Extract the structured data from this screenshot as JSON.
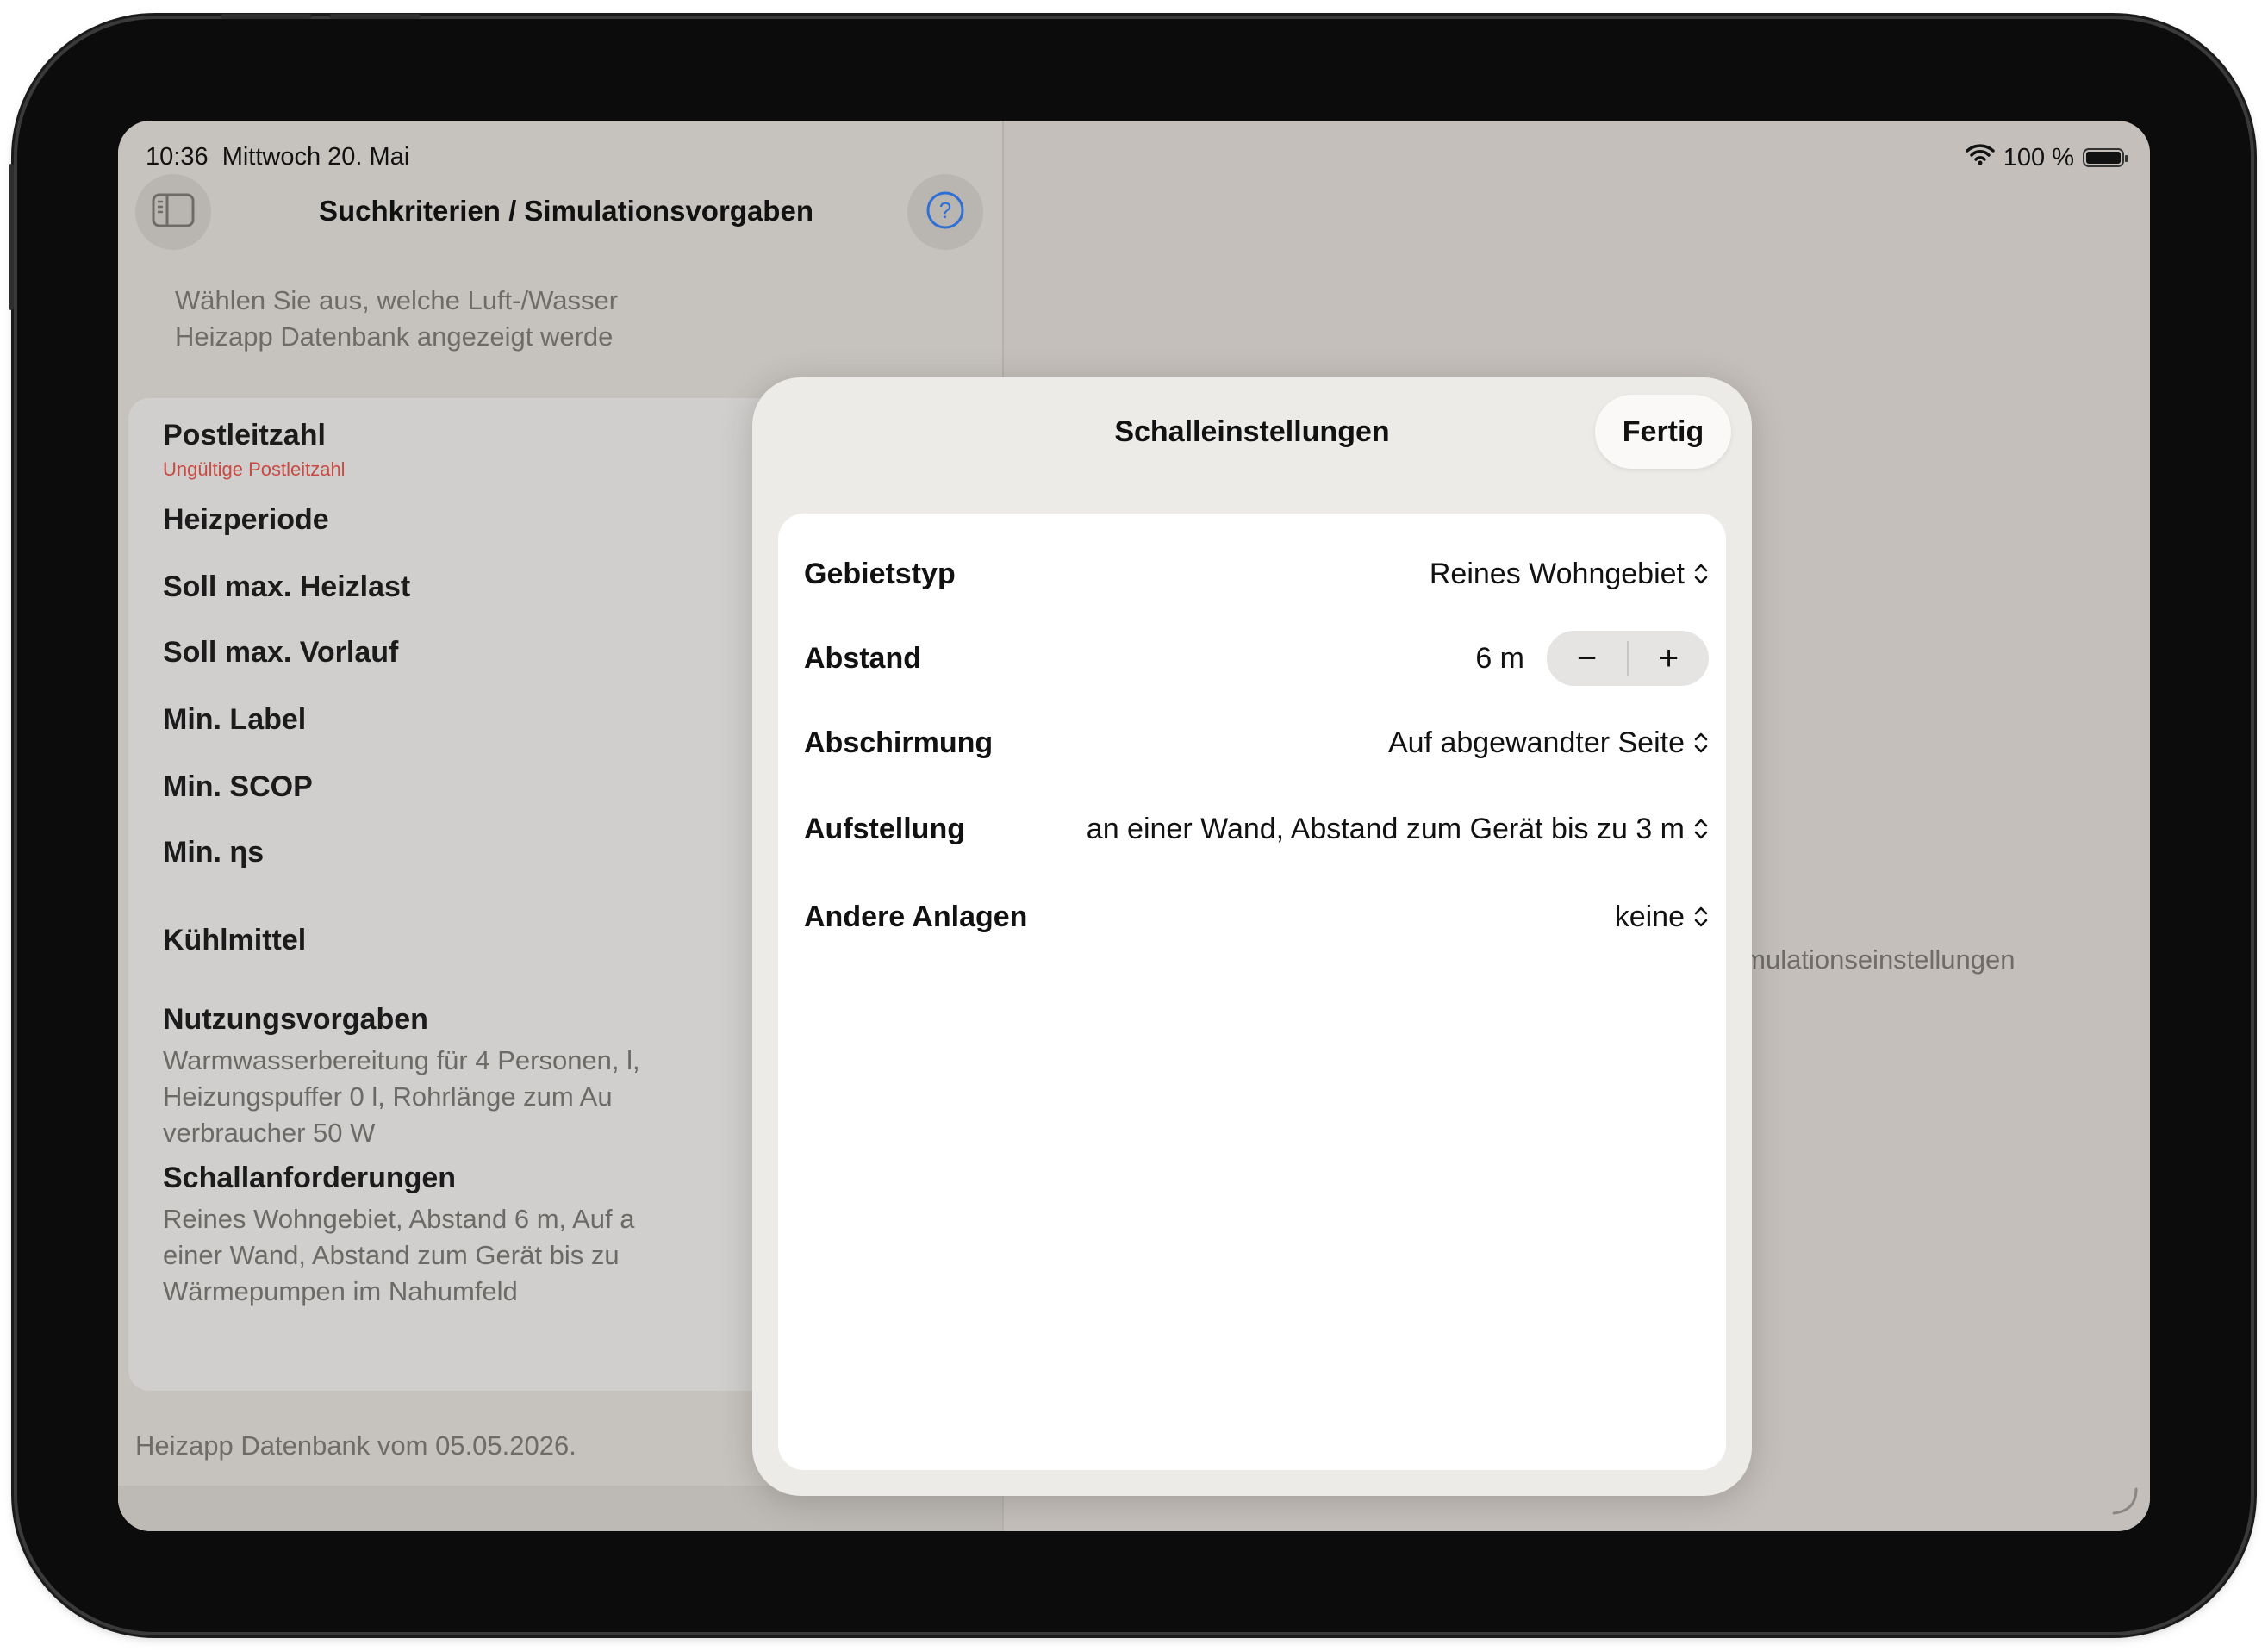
{
  "status_bar": {
    "time": "10:36",
    "date": "Mittwoch 20. Mai",
    "battery_text": "100 %"
  },
  "sidebar": {
    "title": "Suchkriterien / Simulationsvorgaben",
    "intro": "Wählen Sie aus, welche Luft-/Wasser Heizapp Datenbank angezeigt werde",
    "items": [
      {
        "label": "Postleitzahl",
        "error": "Ungültige Postleitzahl"
      },
      {
        "label": "Heizperiode"
      },
      {
        "label": "Soll max. Heizlast"
      },
      {
        "label": "Soll max. Vorlauf"
      },
      {
        "label": "Min. Label"
      },
      {
        "label": "Min. SCOP"
      },
      {
        "label": "Min. ηs"
      },
      {
        "label": "Kühlmittel"
      },
      {
        "label": "Nutzungsvorgaben",
        "detail": "Warmwasserbereitung für 4 Personen, l, Heizungspuffer 0 l, Rohrlänge zum Au verbraucher 50 W"
      },
      {
        "label": "Schallanforderungen",
        "detail": "Reines Wohngebiet, Abstand 6 m, Auf a einer Wand, Abstand zum Gerät bis zu Wärmepumpen im Nahumfeld"
      }
    ],
    "footer": "Heizapp Datenbank vom 05.05.2026."
  },
  "detail_pane": {
    "partial_text": "l in den Simulationseinstellungen"
  },
  "modal": {
    "title": "Schalleinstellungen",
    "done_label": "Fertig",
    "rows": [
      {
        "label": "Gebietstyp",
        "value": "Reines Wohngebiet"
      },
      {
        "label": "Abstand",
        "value": "6 m",
        "decrement": "−",
        "increment": "+"
      },
      {
        "label": "Abschirmung",
        "value": "Auf abgewandter Seite"
      },
      {
        "label": "Aufstellung",
        "value": "an einer Wand, Abstand zum Gerät bis zu 3 m"
      },
      {
        "label": "Andere Anlagen",
        "value": "keine"
      }
    ]
  },
  "colors": {
    "accent": "#2f6fd6",
    "error": "#c84a44"
  },
  "icons": [
    "sidebar-toggle-icon",
    "help-icon",
    "wifi-icon",
    "battery-icon",
    "chevron-up-down-icon",
    "minus-icon",
    "plus-icon"
  ]
}
